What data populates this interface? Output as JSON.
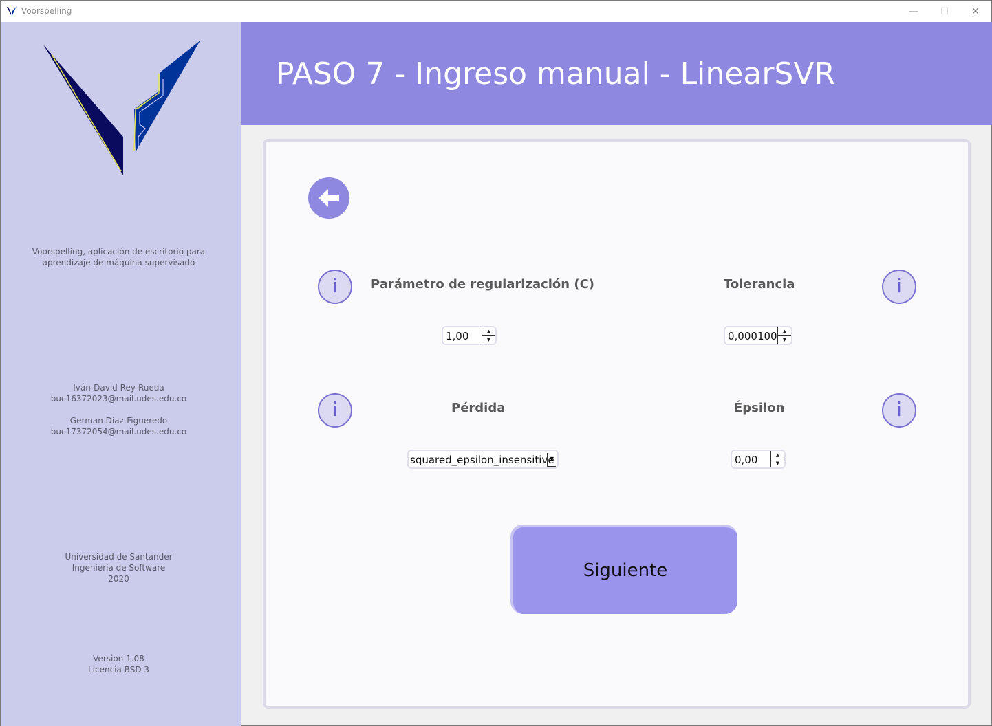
{
  "window": {
    "title": "Voorspelling",
    "minimize_glyph": "—",
    "maximize_glyph": "☐",
    "close_glyph": "✕"
  },
  "sidebar": {
    "description_line1": "Voorspelling, aplicación de escritorio para",
    "description_line2": "aprendizaje de máquina supervisado",
    "author1_name": "Iván-David Rey-Rueda",
    "author1_email": "buc16372023@mail.udes.edu.co",
    "author2_name": "German Diaz-Figueredo",
    "author2_email": "buc17372054@mail.udes.edu.co",
    "university": "Universidad de Santander",
    "program": "Ingeniería de Software",
    "year": "2020",
    "version": "Version 1.08",
    "license": "Licencia BSD 3"
  },
  "header": {
    "title": "PASO 7 - Ingreso manual - LinearSVR"
  },
  "form": {
    "info_glyph": "i",
    "c_label": "Parámetro de regularización (C)",
    "c_value": "1,00",
    "tol_label": "Tolerancia",
    "tol_value": "0,000100",
    "loss_label": "Pérdida",
    "loss_value": "squared_epsilon_insensitive",
    "eps_label": "Épsilon",
    "eps_value": "0,00",
    "spin_up": "▲",
    "spin_down": "▼",
    "dropdown_glyph": "▼",
    "next_label": "Siguiente"
  },
  "colors": {
    "accent": "#8e88e0",
    "sidebar_bg": "#cbcbeb",
    "button_bg": "#9b94ec",
    "logo_dark": "#0a0a5e",
    "logo_blue": "#003399",
    "logo_line": "#e8e84a"
  },
  "icons": {
    "app": "voorspelling-v-icon",
    "back": "arrow-left-icon",
    "info": "info-icon"
  }
}
